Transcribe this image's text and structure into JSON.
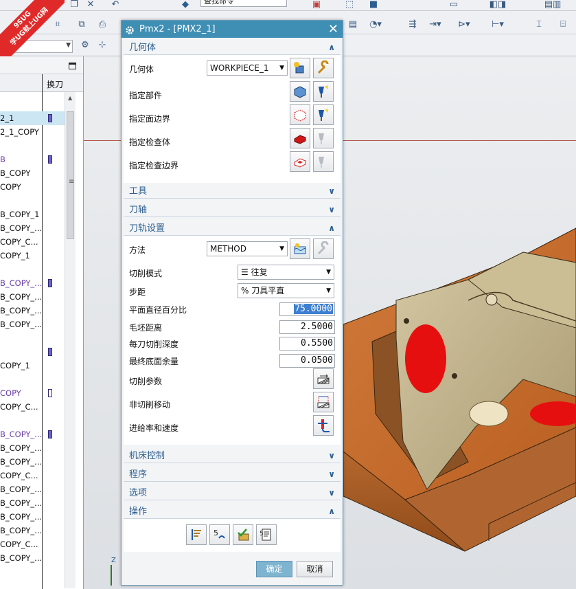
{
  "watermark": {
    "line1": "9SUG",
    "line2": "学UG就上UG网"
  },
  "toolbar": {
    "command_finder_value": "查找命令",
    "step_value": "5"
  },
  "navigator": {
    "column_tool_change": "换刀",
    "rows": [
      {
        "text": "",
        "tool": "none"
      },
      {
        "text": "2_1",
        "tool": "filled",
        "selected": true
      },
      {
        "text": "2_1_COPY",
        "tool": "none"
      },
      {
        "text": "",
        "tool": "none"
      },
      {
        "text": "B",
        "tool": "filled",
        "purple": true
      },
      {
        "text": "B_COPY",
        "tool": "none"
      },
      {
        "text": "COPY",
        "tool": "none"
      },
      {
        "text": "",
        "tool": "none"
      },
      {
        "text": "B_COPY_1",
        "tool": "none"
      },
      {
        "text": "B_COPY_...",
        "tool": "none"
      },
      {
        "text": "COPY_C...",
        "tool": "none"
      },
      {
        "text": "COPY_1",
        "tool": "none"
      },
      {
        "text": "",
        "tool": "none"
      },
      {
        "text": "B_COPY_...",
        "tool": "filled",
        "purple": true
      },
      {
        "text": "B_COPY_...",
        "tool": "none"
      },
      {
        "text": "B_COPY_...",
        "tool": "none"
      },
      {
        "text": "B_COPY_...",
        "tool": "none"
      },
      {
        "text": "",
        "tool": "none"
      },
      {
        "text": "",
        "tool": "filled"
      },
      {
        "text": "COPY_1",
        "tool": "none"
      },
      {
        "text": "",
        "tool": "none"
      },
      {
        "text": "COPY",
        "tool": "ball",
        "purple": true
      },
      {
        "text": "COPY_C...",
        "tool": "none"
      },
      {
        "text": "",
        "tool": "none"
      },
      {
        "text": "B_COPY_...",
        "tool": "filled",
        "purple": true
      },
      {
        "text": "B_COPY_...",
        "tool": "none"
      },
      {
        "text": "B_COPY_...",
        "tool": "none"
      },
      {
        "text": "COPY_C...",
        "tool": "none"
      },
      {
        "text": "B_COPY_...",
        "tool": "none"
      },
      {
        "text": "B_COPY_...",
        "tool": "none"
      },
      {
        "text": "B_COPY_...",
        "tool": "none"
      },
      {
        "text": "B_COPY_...",
        "tool": "none"
      },
      {
        "text": "COPY_C...",
        "tool": "none"
      },
      {
        "text": "B_COPY_...",
        "tool": "none"
      }
    ]
  },
  "dialog": {
    "title": "Pmx2 - [PMX2_1]",
    "sections": {
      "geometry": {
        "header": "几何体",
        "geometry_label": "几何体",
        "geometry_value": "WORKPIECE_1",
        "specify_part": "指定部件",
        "specify_face_boundary": "指定面边界",
        "specify_check_body": "指定检查体",
        "specify_check_boundary": "指定检查边界"
      },
      "tool": {
        "header": "工具"
      },
      "tool_axis": {
        "header": "刀轴"
      },
      "path_settings": {
        "header": "刀轨设置",
        "method_label": "方法",
        "method_value": "METHOD",
        "cut_pattern_label": "切削模式",
        "cut_pattern_value": "往复",
        "stepover_label": "步距",
        "stepover_value": "% 刀具平直",
        "percent_flat_label": "平面直径百分比",
        "percent_flat_value": "75.0000",
        "blank_distance_label": "毛坯距离",
        "blank_distance_value": "2.5000",
        "depth_per_cut_label": "每刀切削深度",
        "depth_per_cut_value": "0.5500",
        "final_floor_stock_label": "最终底面余量",
        "final_floor_stock_value": "0.0500",
        "cutting_params_label": "切削参数",
        "non_cutting_moves_label": "非切削移动",
        "feeds_speeds_label": "进给率和速度"
      },
      "machine_control": {
        "header": "机床控制"
      },
      "program": {
        "header": "程序"
      },
      "options": {
        "header": "选项"
      },
      "actions": {
        "header": "操作"
      }
    },
    "ok_label": "确定",
    "cancel_label": "取消"
  }
}
